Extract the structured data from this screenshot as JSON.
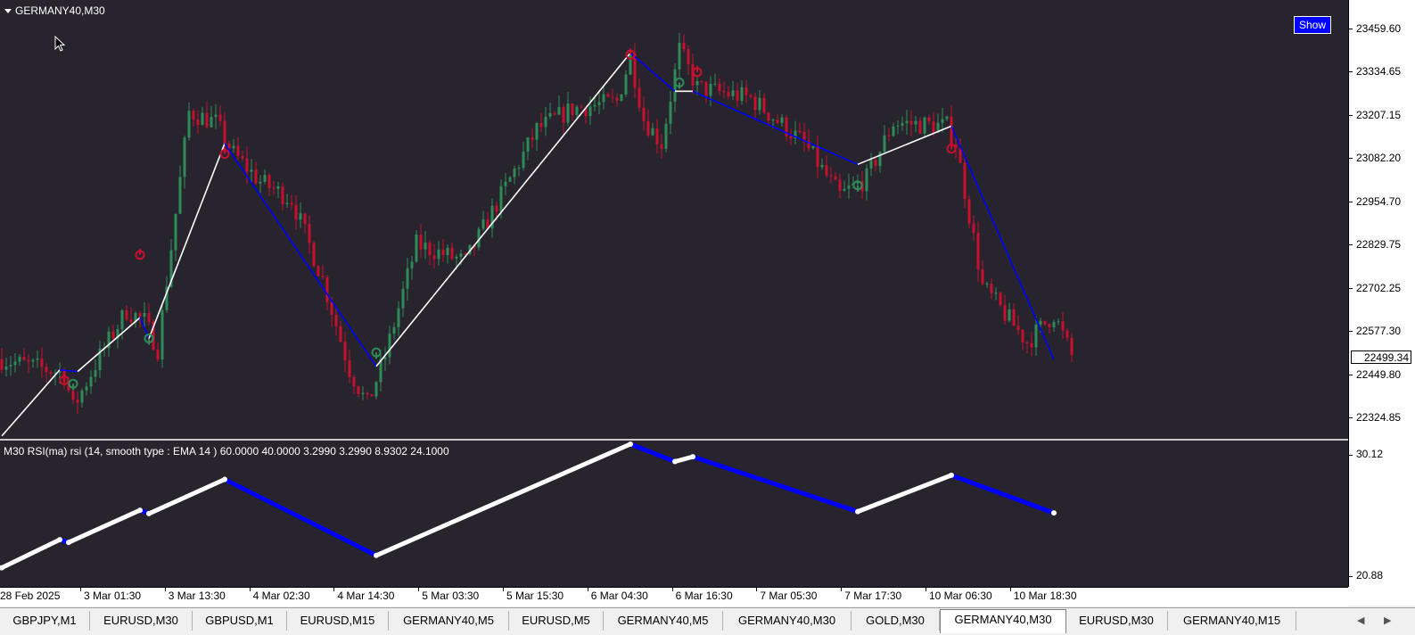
{
  "chart": {
    "title": "GERMANY40,M30",
    "show_button": "Show",
    "current_price": "22499.34",
    "price_axis": [
      "23459.60",
      "23334.65",
      "23207.15",
      "23082.20",
      "22954.70",
      "22829.75",
      "22702.25",
      "22577.30",
      "22449.80",
      "22324.85"
    ],
    "indicator_label": "M30 RSI(ma) rsi (14, smooth type : EMA  14 ) 60.0000 40.0000 3.2990 3.2990 8.9302 24.1000",
    "indicator_axis": [
      "30.12",
      "20.88"
    ],
    "time_axis": [
      "28 Feb 2025",
      "3 Mar 01:30",
      "3 Mar 13:30",
      "4 Mar 02:30",
      "4 Mar 14:30",
      "5 Mar 03:30",
      "5 Mar 15:30",
      "6 Mar 04:30",
      "6 Mar 16:30",
      "7 Mar 05:30",
      "7 Mar 17:30",
      "10 Mar 06:30",
      "10 Mar 18:30"
    ]
  },
  "tabs": [
    {
      "label": "GBPJPY,M1"
    },
    {
      "label": "EURUSD,M30"
    },
    {
      "label": "GBPUSD,M1"
    },
    {
      "label": "EURUSD,M15"
    },
    {
      "label": "GERMANY40,M5"
    },
    {
      "label": "EURUSD,M5"
    },
    {
      "label": "GERMANY40,M5"
    },
    {
      "label": "GERMANY40,M30"
    },
    {
      "label": "GOLD,M30"
    },
    {
      "label": "GERMANY40,M30",
      "active": true
    },
    {
      "label": "EURUSD,M30"
    },
    {
      "label": "GERMANY40,M15"
    }
  ],
  "colors": {
    "background": "#27242e",
    "bull_candle": "#2e8b57",
    "bear_candle": "#c8102e",
    "zigzag_up": "#ffffff",
    "zigzag_down": "#0000ff",
    "signal_up": "#2e8b57",
    "signal_down": "#c8102e"
  },
  "chart_data": [
    {
      "type": "candlestick",
      "title": "GERMANY40,M30",
      "ylim": [
        22262,
        23522
      ],
      "xlabels": [
        "28 Feb 2025",
        "3 Mar 01:30",
        "3 Mar 13:30",
        "4 Mar 02:30",
        "4 Mar 14:30",
        "5 Mar 03:30",
        "5 Mar 15:30",
        "6 Mar 04:30",
        "6 Mar 16:30",
        "7 Mar 05:30",
        "7 Mar 17:30",
        "10 Mar 06:30",
        "10 Mar 18:30"
      ],
      "candle_count": 290,
      "price_path": [
        {
          "i": 0,
          "p": 22490
        },
        {
          "i": 14,
          "p": 22450
        },
        {
          "i": 16,
          "p": 22350
        },
        {
          "i": 22,
          "p": 22500
        },
        {
          "i": 28,
          "p": 22630
        },
        {
          "i": 32,
          "p": 22600
        },
        {
          "i": 35,
          "p": 22520
        },
        {
          "i": 42,
          "p": 23200
        },
        {
          "i": 48,
          "p": 23170
        },
        {
          "i": 52,
          "p": 23080
        },
        {
          "i": 58,
          "p": 23000
        },
        {
          "i": 65,
          "p": 22950
        },
        {
          "i": 72,
          "p": 22720
        },
        {
          "i": 78,
          "p": 22460
        },
        {
          "i": 82,
          "p": 22360
        },
        {
          "i": 86,
          "p": 22500
        },
        {
          "i": 93,
          "p": 22820
        },
        {
          "i": 104,
          "p": 22770
        },
        {
          "i": 112,
          "p": 22960
        },
        {
          "i": 120,
          "p": 23150
        },
        {
          "i": 128,
          "p": 23210
        },
        {
          "i": 138,
          "p": 23230
        },
        {
          "i": 141,
          "p": 23360
        },
        {
          "i": 144,
          "p": 23180
        },
        {
          "i": 148,
          "p": 23110
        },
        {
          "i": 152,
          "p": 23380
        },
        {
          "i": 156,
          "p": 23270
        },
        {
          "i": 168,
          "p": 23240
        },
        {
          "i": 180,
          "p": 23110
        },
        {
          "i": 188,
          "p": 22960
        },
        {
          "i": 194,
          "p": 23010
        },
        {
          "i": 200,
          "p": 23170
        },
        {
          "i": 212,
          "p": 23160
        },
        {
          "i": 214,
          "p": 23110
        },
        {
          "i": 220,
          "p": 22700
        },
        {
          "i": 230,
          "p": 22540
        },
        {
          "i": 236,
          "p": 22620
        },
        {
          "i": 240,
          "p": 22500
        }
      ],
      "zigzag": [
        {
          "time_index": 0,
          "price": 22270
        },
        {
          "time_index": 13,
          "price": 22460
        },
        {
          "time_index": 17,
          "price": 22455
        },
        {
          "time_index": 31,
          "price": 22610
        },
        {
          "time_index": 33,
          "price": 22550
        },
        {
          "time_index": 50,
          "price": 23110
        },
        {
          "time_index": 84,
          "price": 22470
        },
        {
          "time_index": 141,
          "price": 23370
        },
        {
          "time_index": 151,
          "price": 23260
        },
        {
          "time_index": 155,
          "price": 23260
        },
        {
          "time_index": 192,
          "price": 23050
        },
        {
          "time_index": 213,
          "price": 23160
        },
        {
          "time_index": 236,
          "price": 22490
        }
      ],
      "signals": [
        {
          "time_index": 14,
          "price": 22430,
          "kind": "down"
        },
        {
          "time_index": 16,
          "price": 22420,
          "kind": "up"
        },
        {
          "time_index": 31,
          "price": 22790,
          "kind": "down"
        },
        {
          "time_index": 33,
          "price": 22550,
          "kind": "up"
        },
        {
          "time_index": 50,
          "price": 23080,
          "kind": "down"
        },
        {
          "time_index": 84,
          "price": 22510,
          "kind": "up"
        },
        {
          "time_index": 141,
          "price": 23365,
          "kind": "down"
        },
        {
          "time_index": 152,
          "price": 23285,
          "kind": "up"
        },
        {
          "time_index": 156,
          "price": 23315,
          "kind": "down"
        },
        {
          "time_index": 192,
          "price": 22990,
          "kind": "up"
        },
        {
          "time_index": 213,
          "price": 23095,
          "kind": "down"
        }
      ]
    },
    {
      "type": "line",
      "title": "M30 RSI(ma) rsi (14, smooth type : EMA  14 ) 60.0000 40.0000 3.2990 3.2990 8.9302 24.1000",
      "ylim": [
        20.88,
        30.12
      ],
      "series": [
        {
          "points": [
            {
              "time_index": 0,
              "value": 21.1
            },
            {
              "time_index": 13,
              "value": 23.15
            },
            {
              "time_index": 15,
              "value": 22.95
            },
            {
              "time_index": 31,
              "value": 25.3
            },
            {
              "time_index": 33,
              "value": 25.05
            },
            {
              "time_index": 50,
              "value": 27.55
            },
            {
              "time_index": 84,
              "value": 22.0
            },
            {
              "time_index": 141,
              "value": 30.12
            },
            {
              "time_index": 151,
              "value": 28.85
            },
            {
              "time_index": 155,
              "value": 29.2
            },
            {
              "time_index": 192,
              "value": 25.2
            },
            {
              "time_index": 213,
              "value": 27.85
            },
            {
              "time_index": 236,
              "value": 25.1
            }
          ]
        }
      ]
    }
  ]
}
